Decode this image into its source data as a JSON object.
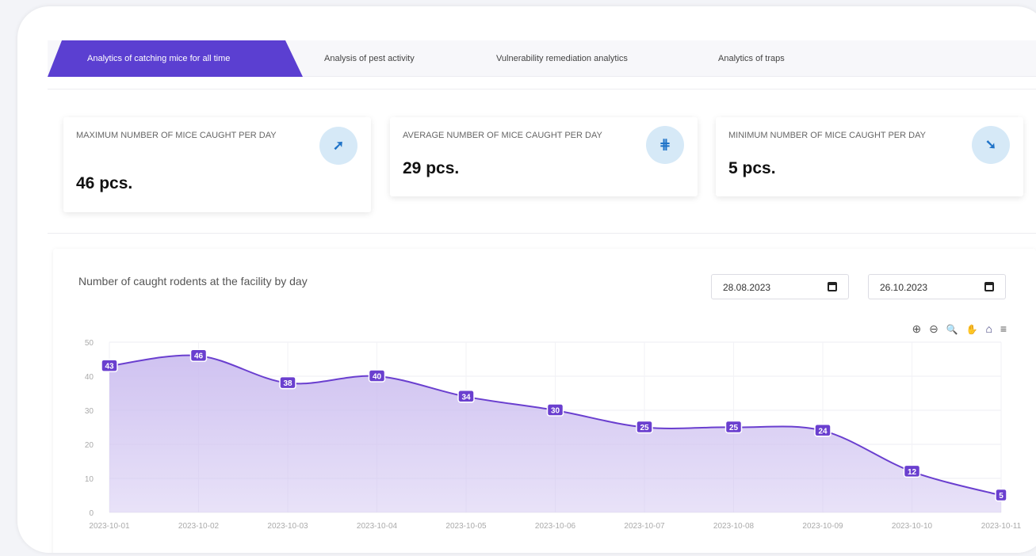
{
  "tabs": [
    {
      "label": "Analytics of catching mice for all time"
    },
    {
      "label": "Analysis of pest activity"
    },
    {
      "label": "Vulnerability remediation analytics"
    },
    {
      "label": "Analytics of traps"
    }
  ],
  "cards": [
    {
      "label": "MAXIMUM NUMBER OF MICE CAUGHT PER DAY",
      "value": "46 pcs.",
      "icon": "arrow-up-right-icon",
      "glyph": "➚"
    },
    {
      "label": "AVERAGE NUMBER OF MICE CAUGHT PER DAY",
      "value": "29 pcs.",
      "icon": "average-icon",
      "glyph": "⋕"
    },
    {
      "label": "MINIMUM NUMBER OF MICE CAUGHT PER DAY",
      "value": "5 pcs.",
      "icon": "arrow-down-right-icon",
      "glyph": "➘"
    }
  ],
  "chart_panel": {
    "title": "Number of caught rodents at the facility by day",
    "date_from": "28.08.2023",
    "date_to": "26.10.2023",
    "toolbar": {
      "zoom_in": "⊕",
      "zoom_out": "⊖",
      "search": "🔍",
      "pan": "✋",
      "home": "⌂",
      "menu": "≡"
    }
  },
  "colors": {
    "accent": "#5b3fd1",
    "line": "#6a3fcf",
    "fill": "#cdbff0",
    "label_bg": "#6a3fcf",
    "icon_bg": "#d6e9f7"
  },
  "chart_data": {
    "type": "area",
    "x": [
      "2023-10-01",
      "2023-10-02",
      "2023-10-03",
      "2023-10-04",
      "2023-10-05",
      "2023-10-06",
      "2023-10-07",
      "2023-10-08",
      "2023-10-09",
      "2023-10-10",
      "2023-10-11"
    ],
    "values": [
      43,
      46,
      38,
      40,
      34,
      30,
      25,
      25,
      24,
      12,
      5
    ],
    "ylim": [
      0,
      50
    ],
    "yticks": [
      0,
      10,
      20,
      30,
      40,
      50
    ],
    "grid": true,
    "data_labels": true,
    "title": "",
    "xlabel": "",
    "ylabel": ""
  }
}
